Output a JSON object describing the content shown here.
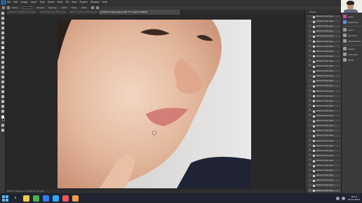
{
  "app": {
    "name": "Photoshop"
  },
  "menu": [
    "File",
    "Edit",
    "Image",
    "Layer",
    "Type",
    "Select",
    "Filter",
    "3D",
    "View",
    "Plugins",
    "Window",
    "Help"
  ],
  "options": {
    "mode_label": "Mode:",
    "mode_value": "Normal",
    "opacity_label": "Opacity:",
    "opacity_value": "100%",
    "flow_label": "Flow:",
    "flow_value": "100%"
  },
  "tabs": [
    {
      "label": "Untitled-1 @ 66.7% (Layer 1, RGB/8)"
    },
    {
      "label": "retouch.psd @ 50% (Layer, RGB/8)"
    },
    {
      "label": "portrait-closeup.jpg @ 66.7% (Layer, RGB/8)"
    }
  ],
  "status": {
    "text": "66.67%   2400 px x 2100 px (72 ppi)"
  },
  "layers": {
    "title": "Layers",
    "row_label": "Retouch brush layer",
    "count": 36
  },
  "side_panel": [
    {
      "label": "Color",
      "icon": "color-icon",
      "color": "#c94a9a"
    },
    {
      "label": "Swatches",
      "icon": "swatches-icon",
      "color": "#6a8fd8"
    },
    {
      "label": "Learn",
      "icon": "learn-icon",
      "color": "#9a9a9a"
    },
    {
      "label": "Libraries",
      "icon": "libraries-icon",
      "color": "#9a9a9a"
    },
    {
      "label": "Adjustments",
      "icon": "adjustments-icon",
      "color": "#9a9a9a"
    },
    {
      "label": "Layers",
      "icon": "layers-icon",
      "color": "#9a9a9a"
    },
    {
      "label": "Channels",
      "icon": "channels-icon",
      "color": "#9a9a9a"
    },
    {
      "label": "Paths",
      "icon": "paths-icon",
      "color": "#9a9a9a"
    }
  ],
  "taskbar": {
    "search_glyph": "⌕",
    "apps": [
      {
        "name": "file-explorer-icon",
        "color": "#f2c94c"
      },
      {
        "name": "chrome-icon",
        "color": "#4caf50"
      },
      {
        "name": "edge-icon",
        "color": "#2f80ed"
      },
      {
        "name": "photoshop-icon",
        "color": "#31a8ff"
      },
      {
        "name": "media-icon",
        "color": "#eb5757"
      },
      {
        "name": "folder-icon",
        "color": "#f2994a"
      }
    ],
    "time": "18:19",
    "date": "06.12.2023"
  }
}
